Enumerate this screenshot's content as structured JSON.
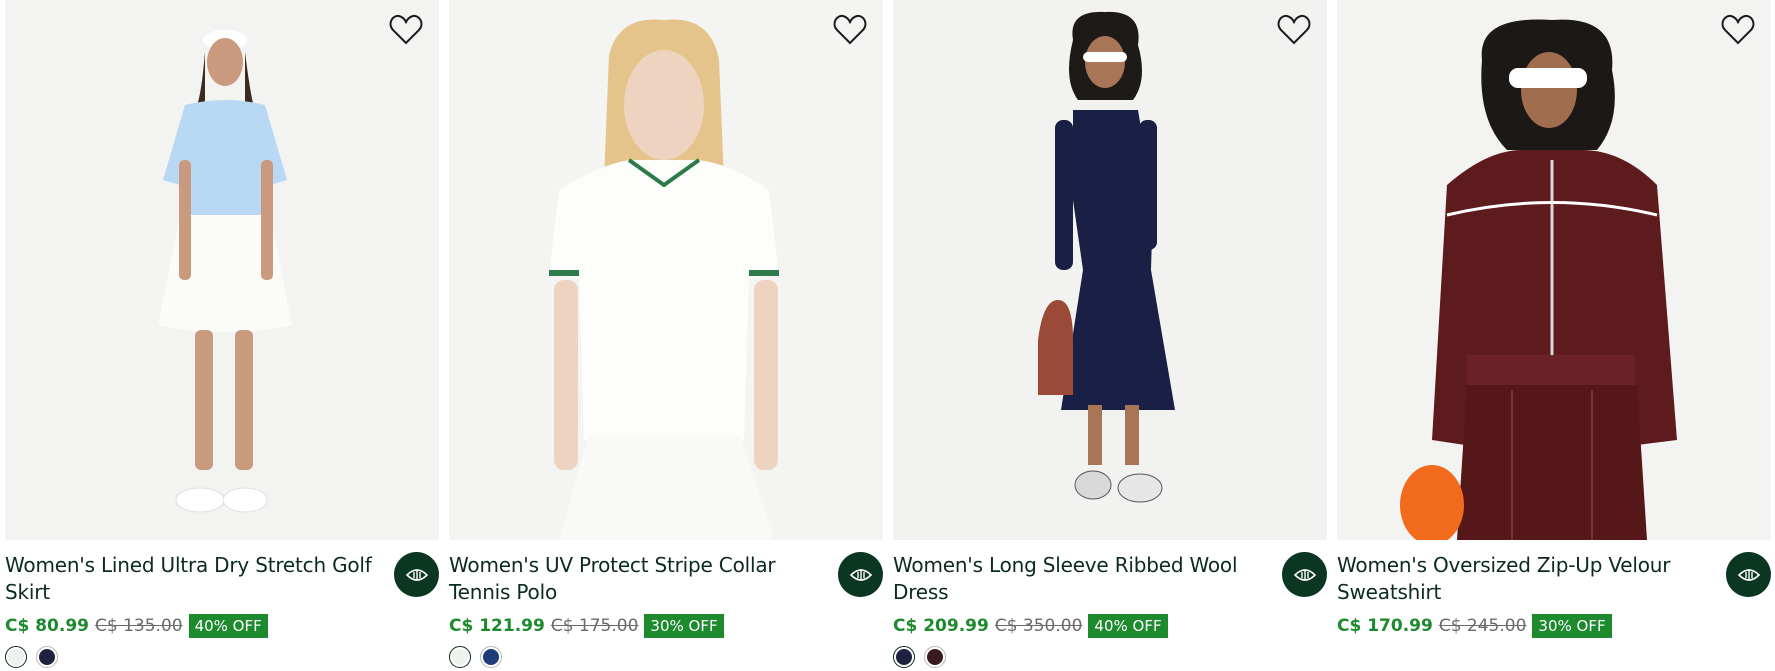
{
  "products": [
    {
      "title": "Women's Lined Ultra Dry Stretch Golf Skirt",
      "sale_price": "C$ 80.99",
      "original_price": "C$ 135.00",
      "discount": "40% OFF",
      "swatches": [
        "#eef1ec",
        "#1d2240"
      ],
      "wishlist_icon": "heart-outline-icon",
      "quickview_icon": "eye-icon"
    },
    {
      "title": "Women's UV Protect Stripe Collar Tennis Polo",
      "sale_price": "C$ 121.99",
      "original_price": "C$ 175.00",
      "discount": "30% OFF",
      "swatches": [
        "#eef1ec",
        "#1f3b7a"
      ],
      "wishlist_icon": "heart-outline-icon",
      "quickview_icon": "eye-icon"
    },
    {
      "title": "Women's Long Sleeve Ribbed Wool Dress",
      "sale_price": "C$ 209.99",
      "original_price": "C$ 350.00",
      "discount": "40% OFF",
      "swatches": [
        "#1d2240",
        "#3a1a20"
      ],
      "wishlist_icon": "heart-outline-icon",
      "quickview_icon": "eye-icon"
    },
    {
      "title": "Women's Oversized Zip-Up Velour Sweatshirt",
      "sale_price": "C$ 170.99",
      "original_price": "C$ 245.00",
      "discount": "30% OFF",
      "swatches": [],
      "wishlist_icon": "heart-outline-icon",
      "quickview_icon": "eye-icon"
    }
  ],
  "colors": {
    "sale": "#1d8a2e",
    "badge_bg": "#1d8a2e",
    "quickview_bg": "#0b3622",
    "text": "#0b2b1e"
  }
}
